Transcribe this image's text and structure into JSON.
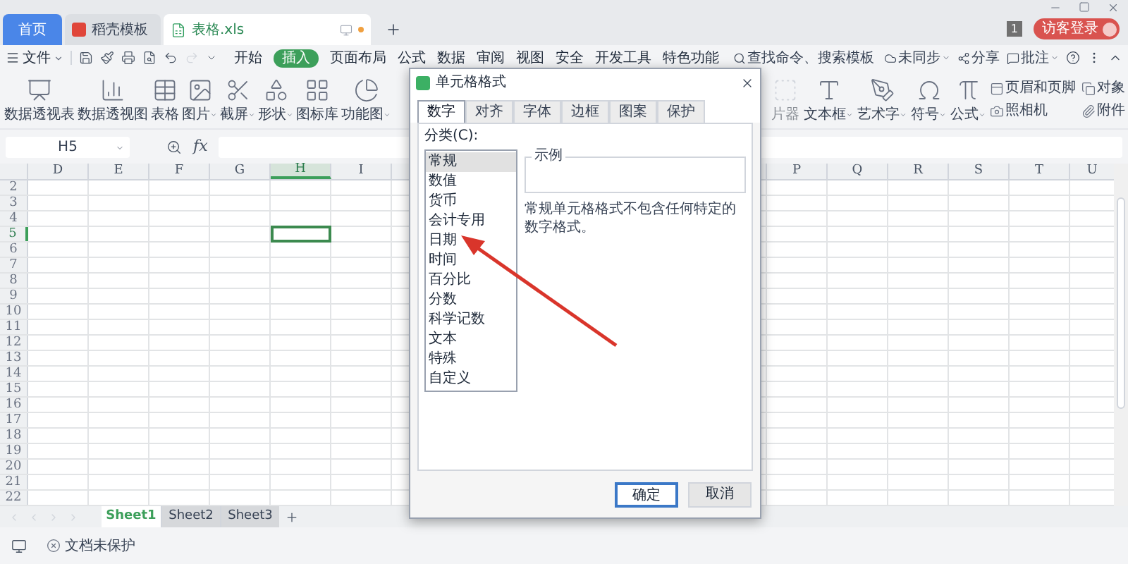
{
  "tabs": [
    {
      "label": "首页",
      "kind": "home",
      "selected": false
    },
    {
      "label": "稻壳模板",
      "kind": "docer",
      "selected": false
    },
    {
      "label": "表格.xls",
      "kind": "file",
      "selected": true
    }
  ],
  "notice_badge": "1",
  "login_button": "访客登录",
  "menu": {
    "file": "文件",
    "tabs": [
      {
        "label": "开始",
        "selected": false
      },
      {
        "label": "插入",
        "selected": true
      },
      {
        "label": "页面布局",
        "selected": false
      },
      {
        "label": "公式",
        "selected": false
      },
      {
        "label": "数据",
        "selected": false
      },
      {
        "label": "审阅",
        "selected": false
      },
      {
        "label": "视图",
        "selected": false
      },
      {
        "label": "安全",
        "selected": false
      },
      {
        "label": "开发工具",
        "selected": false
      },
      {
        "label": "特色功能",
        "selected": false
      }
    ],
    "search_placeholder": "查找命令、搜索模板",
    "actions": [
      {
        "label": "未同步",
        "kind": "sync",
        "dropdown": true
      },
      {
        "label": "分享",
        "kind": "share",
        "dropdown": false
      },
      {
        "label": "批注",
        "kind": "comment",
        "dropdown": true
      }
    ]
  },
  "ribbon_left": [
    {
      "label": "数据透视表",
      "kind": "pivot-table",
      "dropdown": false
    },
    {
      "label": "数据透视图",
      "kind": "pivot-chart",
      "dropdown": false
    },
    {
      "label": "表格",
      "kind": "table",
      "dropdown": false
    },
    {
      "label": "图片",
      "kind": "picture",
      "dropdown": true
    },
    {
      "label": "截屏",
      "kind": "screenshot",
      "dropdown": true
    },
    {
      "label": "形状",
      "kind": "shapes",
      "dropdown": true
    },
    {
      "label": "图标库",
      "kind": "icons",
      "dropdown": false
    },
    {
      "label": "功能图",
      "kind": "function-chart",
      "dropdown": true
    }
  ],
  "ribbon_right": [
    {
      "label": "片器",
      "kind": "slicer",
      "dropdown": false,
      "disabled": true
    },
    {
      "label": "文本框",
      "kind": "textbox",
      "dropdown": true,
      "disabled": false
    },
    {
      "label": "艺术字",
      "kind": "wordart",
      "dropdown": true,
      "disabled": false
    },
    {
      "label": "符号",
      "kind": "symbol",
      "dropdown": true,
      "disabled": false
    },
    {
      "label": "公式",
      "kind": "equation",
      "dropdown": true,
      "disabled": false
    }
  ],
  "ribbon_small": [
    {
      "label": "页眉和页脚",
      "kind": "header-footer"
    },
    {
      "label": "照相机",
      "kind": "camera"
    },
    {
      "label": "对象",
      "kind": "object"
    },
    {
      "label": "附件",
      "kind": "attachment"
    }
  ],
  "name_box": "H5",
  "formula_label": "fx",
  "columns_left": [
    {
      "label": "D",
      "selected": false
    },
    {
      "label": "E",
      "selected": false
    },
    {
      "label": "F",
      "selected": false
    },
    {
      "label": "G",
      "selected": false
    },
    {
      "label": "H",
      "selected": true
    },
    {
      "label": "I",
      "selected": false
    }
  ],
  "columns_right": [
    {
      "label": "P",
      "selected": false
    },
    {
      "label": "Q",
      "selected": false
    },
    {
      "label": "R",
      "selected": false
    },
    {
      "label": "S",
      "selected": false
    },
    {
      "label": "T",
      "selected": false
    },
    {
      "label": "U",
      "selected": false
    }
  ],
  "rows": [
    {
      "label": "2",
      "selected": false
    },
    {
      "label": "3",
      "selected": false
    },
    {
      "label": "4",
      "selected": false
    },
    {
      "label": "5",
      "selected": true
    },
    {
      "label": "6",
      "selected": false
    },
    {
      "label": "7",
      "selected": false
    },
    {
      "label": "8",
      "selected": false
    },
    {
      "label": "9",
      "selected": false
    },
    {
      "label": "10",
      "selected": false
    },
    {
      "label": "11",
      "selected": false
    },
    {
      "label": "12",
      "selected": false
    },
    {
      "label": "13",
      "selected": false
    },
    {
      "label": "14",
      "selected": false
    },
    {
      "label": "15",
      "selected": false
    },
    {
      "label": "16",
      "selected": false
    },
    {
      "label": "17",
      "selected": false
    },
    {
      "label": "18",
      "selected": false
    },
    {
      "label": "19",
      "selected": false
    },
    {
      "label": "20",
      "selected": false
    },
    {
      "label": "21",
      "selected": false
    },
    {
      "label": "22",
      "selected": false
    }
  ],
  "sheet_tabs": [
    {
      "label": "Sheet1",
      "selected": true
    },
    {
      "label": "Sheet2",
      "selected": false
    },
    {
      "label": "Sheet3",
      "selected": false
    }
  ],
  "status_bar": {
    "protection": "文档未保护"
  },
  "dialog": {
    "title": "单元格格式",
    "tabs": [
      {
        "label": "数字",
        "selected": true
      },
      {
        "label": "对齐",
        "selected": false
      },
      {
        "label": "字体",
        "selected": false
      },
      {
        "label": "边框",
        "selected": false
      },
      {
        "label": "图案",
        "selected": false
      },
      {
        "label": "保护",
        "selected": false
      }
    ],
    "category_label": "分类(C):",
    "categories": [
      {
        "label": "常规",
        "selected": true
      },
      {
        "label": "数值",
        "selected": false
      },
      {
        "label": "货币",
        "selected": false
      },
      {
        "label": "会计专用",
        "selected": false
      },
      {
        "label": "日期",
        "selected": false
      },
      {
        "label": "时间",
        "selected": false
      },
      {
        "label": "百分比",
        "selected": false
      },
      {
        "label": "分数",
        "selected": false
      },
      {
        "label": "科学记数",
        "selected": false
      },
      {
        "label": "文本",
        "selected": false
      },
      {
        "label": "特殊",
        "selected": false
      },
      {
        "label": "自定义",
        "selected": false
      }
    ],
    "sample_label": "示例",
    "description": "常规单元格格式不包含任何特定的数字格式。",
    "buttons": [
      {
        "label": "确定",
        "kind": "primary"
      },
      {
        "label": "取消",
        "kind": "secondary"
      }
    ]
  }
}
